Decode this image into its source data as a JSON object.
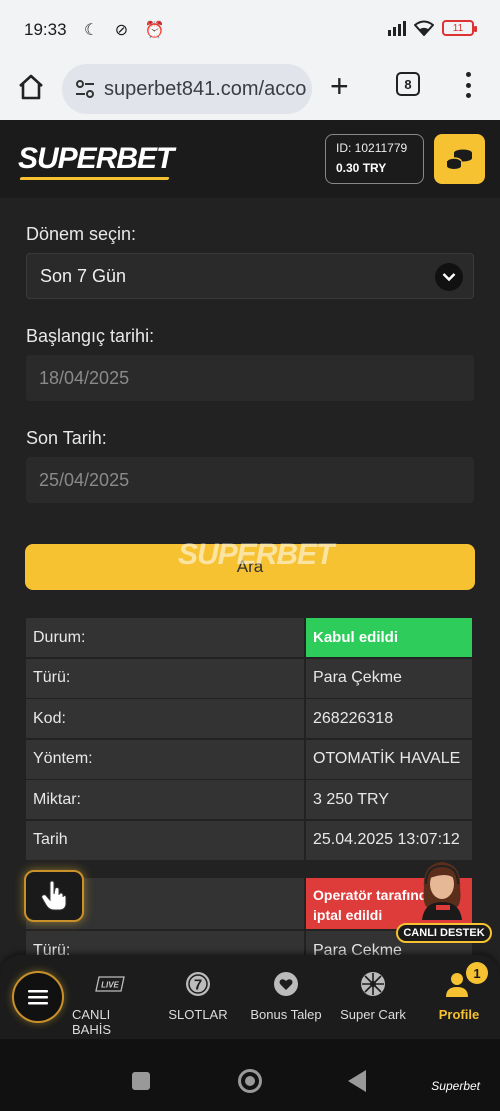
{
  "status_bar": {
    "time": "19:33",
    "icons_left": "☾ ⊘ ⏰",
    "battery": "11"
  },
  "browser": {
    "url": "superbet841.com/acco",
    "tab_count": "8",
    "icons": [
      "home-icon",
      "site-settings-icon",
      "new-tab-icon",
      "tab-switcher-icon",
      "menu-icon"
    ]
  },
  "header": {
    "logo": "SUPERBET",
    "account_id": "ID: 10211779",
    "balance": "0.30 TRY"
  },
  "filter": {
    "period_label": "Dönem seçin:",
    "period_value": "Son 7 Gün",
    "start_label": "Başlangıç tarihi:",
    "start_placeholder": "18/04/2025",
    "end_label": "Son Tarih:",
    "end_placeholder": "25/04/2025",
    "search_label": "Ara",
    "watermark": "SUPERBET"
  },
  "transactions": [
    {
      "rows": [
        {
          "key": "Durum:",
          "value": "Kabul edildi",
          "status": "ok"
        },
        {
          "key": "Türü:",
          "value": "Para Çekme"
        },
        {
          "key": "Kod:",
          "value": "268226318"
        },
        {
          "key": "Yöntem:",
          "value": "OTOMATİK HAVALE"
        },
        {
          "key": "Miktar:",
          "value": "3 250 TRY"
        },
        {
          "key": "Tarih",
          "value": "25.04.2025 13:07:12"
        }
      ]
    },
    {
      "rows": [
        {
          "key": "",
          "value": "Operatör tarafından iptal edildi",
          "status": "cancel"
        },
        {
          "key": "Türü:",
          "value": "Para Çekme"
        }
      ]
    }
  ],
  "colors": {
    "accent": "#f6c232",
    "ok": "#2ecc5b",
    "cancel": "#de3b3b",
    "background": "#222222"
  },
  "support": {
    "label": "CANLI DESTEK"
  },
  "bottom_nav": {
    "items": [
      {
        "label": "CANLI BAHİS",
        "icon": "live-icon"
      },
      {
        "label": "SLOTLAR",
        "icon": "slot-seven-icon"
      },
      {
        "label": "Bonus Talep",
        "icon": "heart-icon"
      },
      {
        "label": "Super Cark",
        "icon": "wheel-icon"
      },
      {
        "label": "Profile",
        "icon": "profile-icon",
        "active": true
      }
    ],
    "profile_badge": "1",
    "live_tag": "LIVE"
  },
  "system_nav": {
    "label": "Superbet"
  }
}
